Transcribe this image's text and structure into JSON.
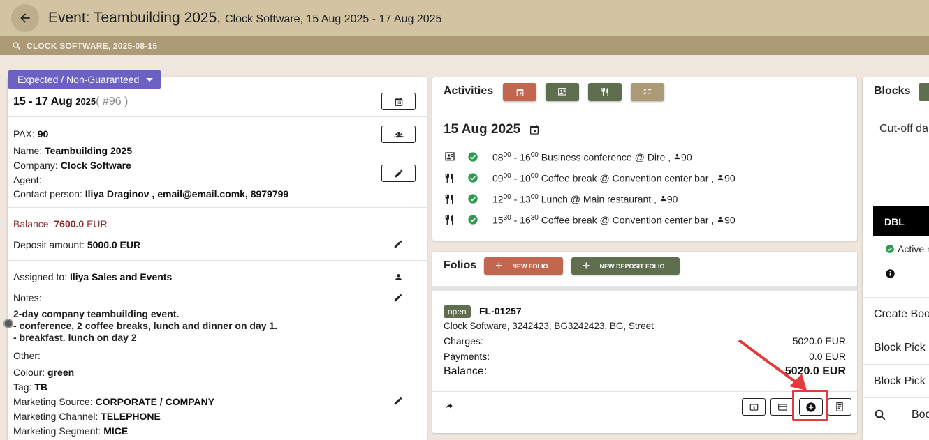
{
  "header": {
    "title_main": "Event: Teambuilding 2025,",
    "title_sub": "Clock Software, 15 Aug 2025 - 17 Aug 2025",
    "search_text": "CLOCK SOFTWARE, 2025-08-15"
  },
  "event": {
    "status": "Expected / Non-Guaranteed",
    "dates_main": "15 - 17 Aug",
    "dates_year": "2025",
    "number": "( #96 )",
    "pax_label": "PAX:",
    "pax_value": "90",
    "name_label": "Name:",
    "name_value": "Teambuilding 2025",
    "company_label": "Company:",
    "company_value": "Clock Software",
    "agent_label": "Agent:",
    "contact_label": "Contact person:",
    "contact_value": "Iliya Draginov , email@email.comk, 8979799",
    "balance_label": "Balance:",
    "balance_value": "7600.0",
    "balance_currency": "EUR",
    "deposit_label": "Deposit amount:",
    "deposit_value": "5000.0 EUR",
    "assigned_label": "Assigned to:",
    "assigned_value": "Iliya  Sales and Events",
    "notes_label": "Notes:",
    "notes_line1": "2-day company teambuilding event.",
    "notes_line2": "- conference, 2 coffee breaks, lunch and dinner on day 1.",
    "notes_line3": "- breakfast. lunch on day 2",
    "other_label": "Other:",
    "colour_label": "Colour:",
    "colour_value": "green",
    "tag_label": "Tag:",
    "tag_value": "TB",
    "msource_label": "Marketing Source:",
    "msource_value": "CORPORATE / COMPANY",
    "mchannel_label": "Marketing Channel:",
    "mchannel_value": "TELEPHONE",
    "msegment_label": "Marketing Segment:",
    "msegment_value": "MICE"
  },
  "activities": {
    "title": "Activities",
    "date": "15 Aug 2025",
    "items": [
      {
        "start_h": "08",
        "start_m": "00",
        "end_h": "16",
        "end_m": "00",
        "text": "Business conference @ Dire ,",
        "pax": "90",
        "icon": "presentation-icon"
      },
      {
        "start_h": "09",
        "start_m": "00",
        "end_h": "10",
        "end_m": "00",
        "text": "Coffee break @ Convention center bar ,",
        "pax": "90",
        "icon": "cutlery-icon"
      },
      {
        "start_h": "12",
        "start_m": "00",
        "end_h": "13",
        "end_m": "00",
        "text": "Lunch @ Main restaurant ,",
        "pax": "90",
        "icon": "cutlery-icon"
      },
      {
        "start_h": "15",
        "start_m": "30",
        "end_h": "16",
        "end_m": "30",
        "text": "Coffee break @ Convention center bar ,",
        "pax": "90",
        "icon": "cutlery-icon"
      }
    ]
  },
  "folios": {
    "title": "Folios",
    "new_folio": "NEW FOLIO",
    "new_deposit_folio": "NEW DEPOSIT FOLIO",
    "status": "open",
    "number": "FL-01257",
    "address": "Clock Software, 3242423, BG3242423, BG, Street",
    "charges_label": "Charges:",
    "charges_value": "5020.0 EUR",
    "payments_label": "Payments:",
    "payments_value": "0.0 EUR",
    "balance_label": "Balance:",
    "balance_value": "5020.0 EUR"
  },
  "blocks": {
    "title": "Blocks",
    "cutoff": "Cut-off da",
    "room_type": "DBL",
    "active": "Active r",
    "create": "Create Boo",
    "pick1": "Block Pick",
    "pick2": "Block Pick",
    "search": "Boo"
  },
  "colors": {
    "header": "#d2c3a1",
    "subheader": "#ab9a75",
    "status_pill": "#6b61c2",
    "new_folio": "#c2664f",
    "new_deposit": "#5e6e4e",
    "balance": "#8b2d2d"
  }
}
